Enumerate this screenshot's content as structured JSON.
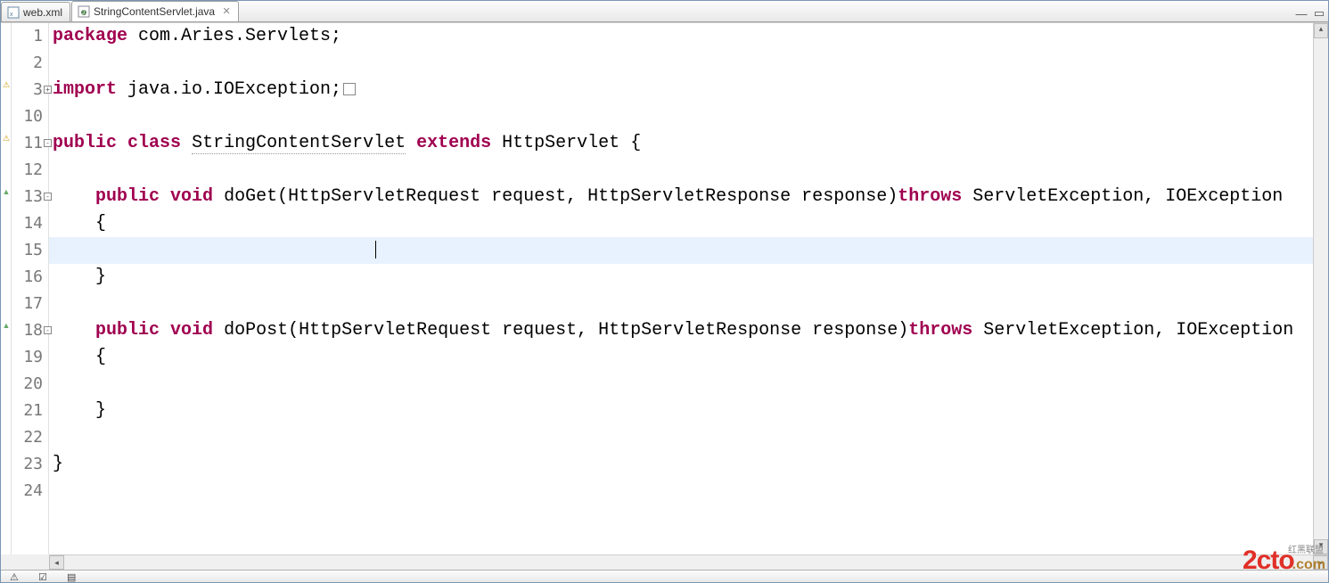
{
  "tabs": [
    {
      "label": "web.xml",
      "active": false
    },
    {
      "label": "StringContentServlet.java",
      "active": true
    }
  ],
  "gutter": {
    "lines": [
      "1",
      "2",
      "3",
      "10",
      "11",
      "12",
      "13",
      "14",
      "15",
      "16",
      "17",
      "18",
      "19",
      "20",
      "21",
      "22",
      "23",
      "24"
    ],
    "folds": {
      "3": "+",
      "11": "-",
      "13": "-",
      "18": "-"
    },
    "marks": {
      "3": "warn",
      "11": "warn",
      "13": "override",
      "18": "override"
    }
  },
  "code": {
    "l1": {
      "pre": "",
      "kw1": "package",
      "rest": " com.Aries.Servlets;"
    },
    "l2": "",
    "l3": {
      "pre": "",
      "kw1": "import",
      "rest": " java.io.IOException;"
    },
    "l10": "",
    "l11": {
      "kw1": "public",
      "kw2": "class",
      "name": "StringContentServlet",
      "kw3": "extends",
      "sup": "HttpServlet",
      "tail": " {"
    },
    "l12": "",
    "l13": {
      "ind": "    ",
      "kw1": "public",
      "kw2": "void",
      "m": "doGet(HttpServletRequest request, HttpServletResponse response)",
      "kw3": "throws",
      "e": " ServletException, IOException"
    },
    "l14": "    {",
    "l15": "",
    "l16": "    }",
    "l17": "",
    "l18": {
      "ind": "    ",
      "kw1": "public",
      "kw2": "void",
      "m": "doPost(HttpServletRequest request, HttpServletResponse response)",
      "kw3": "throws",
      "e": " ServletException, IOException"
    },
    "l19": "    {",
    "l20": "",
    "l21": "    }",
    "l22": "",
    "l23": "}",
    "l24": ""
  },
  "watermark": {
    "brand": "2cto",
    "domain": ".com",
    "cn": "红黑联盟"
  }
}
